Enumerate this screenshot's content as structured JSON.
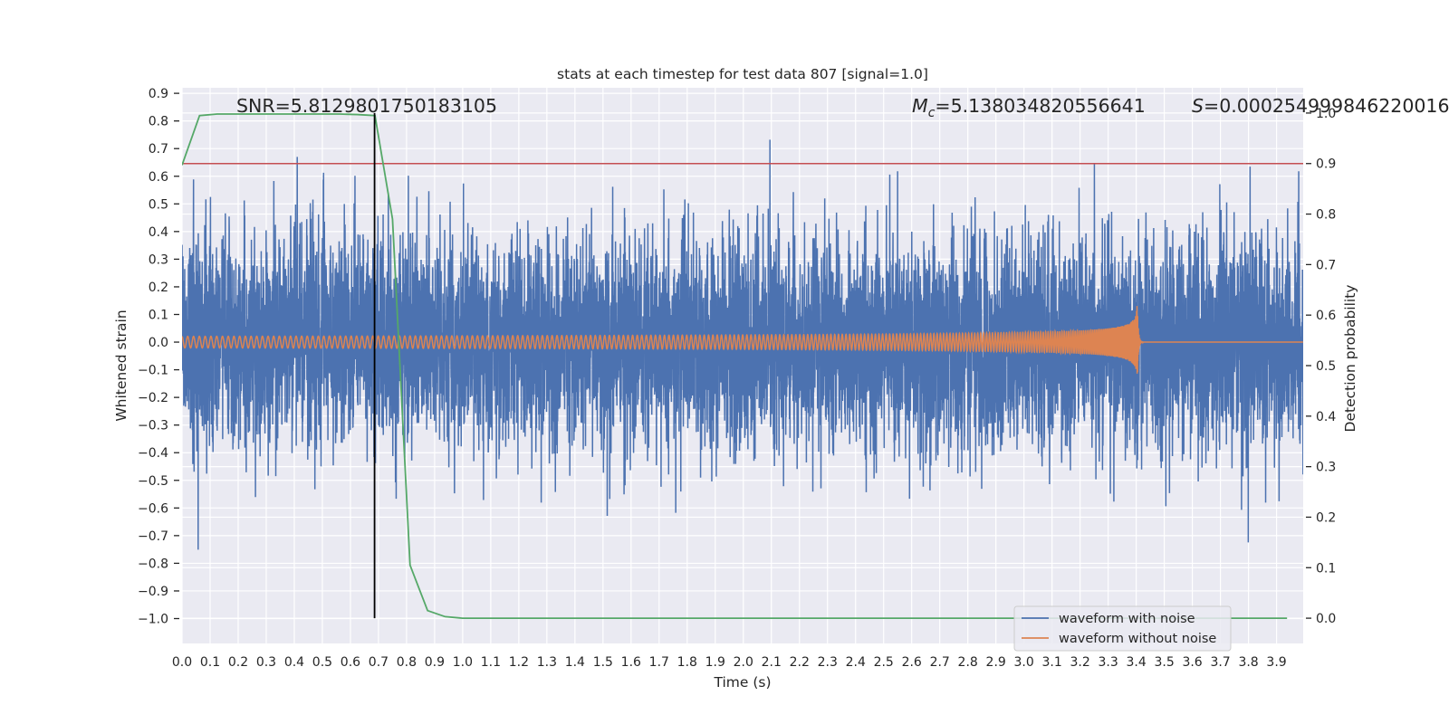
{
  "chart_data": {
    "type": "line",
    "title": "stats at each timestep for test data 807 [signal=1.0]",
    "xlabel": "Time (s)",
    "ylabel": "Whitened strain",
    "ylabel_right": "Detection probability",
    "xlim": [
      0,
      3.995
    ],
    "ylim": [
      -1.09,
      0.92
    ],
    "ylim_right": [
      -0.05,
      1.05
    ],
    "grid": true,
    "background_color": "#eaeaf2",
    "xticks": [
      "0.0",
      "0.1",
      "0.2",
      "0.3",
      "0.4",
      "0.5",
      "0.6",
      "0.7",
      "0.8",
      "0.9",
      "1.0",
      "1.1",
      "1.2",
      "1.3",
      "1.4",
      "1.5",
      "1.6",
      "1.7",
      "1.8",
      "1.9",
      "2.0",
      "2.1",
      "2.2",
      "2.3",
      "2.4",
      "2.5",
      "2.6",
      "2.7",
      "2.8",
      "2.9",
      "3.0",
      "3.1",
      "3.2",
      "3.3",
      "3.4",
      "3.5",
      "3.6",
      "3.7",
      "3.8",
      "3.9"
    ],
    "yticks": [
      "0.9",
      "0.8",
      "0.7",
      "0.6",
      "0.5",
      "0.4",
      "0.3",
      "0.2",
      "0.1",
      "0.0",
      "−0.1",
      "−0.2",
      "−0.3",
      "−0.4",
      "−0.5",
      "−0.6",
      "−0.7",
      "−0.8",
      "−0.9",
      "−1.0"
    ],
    "yticks_right": [
      "0.0",
      "0.1",
      "0.2",
      "0.3",
      "0.4",
      "0.5",
      "0.6",
      "0.7",
      "0.8",
      "0.9",
      "1.0"
    ],
    "annotations": {
      "snr": "SNR=5.8129801750183105",
      "mc": {
        "symbol": "M",
        "subscript": "c",
        "value": "=5.138034820556641"
      },
      "s": {
        "symbol": "S",
        "value": "=0.000254999846220016"
      }
    },
    "series": {
      "noise": {
        "name": "waveform with noise",
        "color": "#4c72b0",
        "axis": "left"
      },
      "chirp": {
        "name": "waveform without noise",
        "color": "#dd8452",
        "axis": "left",
        "merger_time": 3.4
      },
      "detection_probability": {
        "color": "#55a868",
        "axis": "right",
        "x": [
          0,
          0.0625,
          0.125,
          0.1875,
          0.25,
          0.3125,
          0.375,
          0.4375,
          0.5,
          0.5625,
          0.625,
          0.6875,
          0.75,
          0.8125,
          0.875,
          0.9375,
          1.0,
          1.0625,
          1.125,
          1.1875,
          1.25,
          1.3125,
          1.375,
          1.4375,
          1.5,
          1.5625,
          1.625,
          1.6875,
          1.75,
          1.8125,
          1.875,
          1.9375,
          2.0,
          2.0625,
          2.125,
          2.1875,
          2.25,
          2.3125,
          2.375,
          2.4375,
          2.5,
          2.5625,
          2.625,
          2.6875,
          2.75,
          2.8125,
          2.875,
          2.9375,
          3.0,
          3.0625,
          3.125,
          3.1875,
          3.25,
          3.3125,
          3.375,
          3.4375,
          3.5,
          3.5625,
          3.625,
          3.6875,
          3.75,
          3.8125,
          3.875,
          3.9375
        ],
        "y": [
          0.897,
          0.995,
          0.998,
          0.998,
          0.998,
          0.998,
          0.998,
          0.998,
          0.998,
          0.998,
          0.997,
          0.995,
          0.79,
          0.105,
          0.015,
          0.003,
          0,
          0,
          0,
          0,
          0,
          0,
          0,
          0,
          0,
          0,
          0,
          0,
          0,
          0,
          0,
          0,
          0,
          0,
          0,
          0,
          0,
          0,
          0,
          0,
          0,
          0,
          0,
          0,
          0,
          0,
          0,
          0,
          0,
          0,
          0,
          0,
          0,
          0,
          0,
          0,
          0,
          0,
          0,
          0,
          0,
          0,
          0,
          0
        ]
      },
      "threshold": {
        "value": 0.9,
        "color": "#c44e52",
        "axis": "right"
      },
      "detection_marker": {
        "x": 0.686,
        "color": "#000000"
      }
    },
    "legend": {
      "position": "lower right",
      "entries": [
        {
          "label": "waveform with noise",
          "color": "#4c72b0"
        },
        {
          "label": "waveform without noise",
          "color": "#dd8452"
        }
      ]
    }
  }
}
